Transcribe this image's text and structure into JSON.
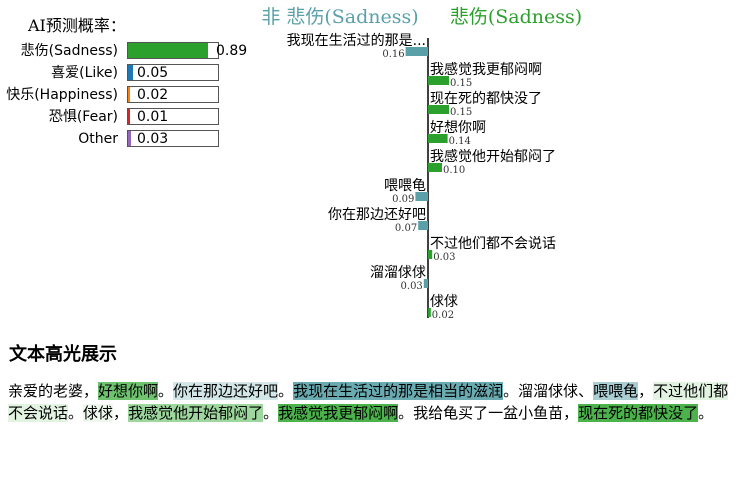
{
  "probability_panel": {
    "title": "AI预测概率：",
    "rows": [
      {
        "label": "悲伤(Sadness)",
        "value": 0.89,
        "value_text": "0.89",
        "color": "#2ca02c"
      },
      {
        "label": "喜爱(Like)",
        "value": 0.05,
        "value_text": "0.05",
        "color": "#1f77b4"
      },
      {
        "label": "快乐(Happiness)",
        "value": 0.02,
        "value_text": "0.02",
        "color": "#ff7f0e"
      },
      {
        "label": "恐惧(Fear)",
        "value": 0.01,
        "value_text": "0.01",
        "color": "#d62728"
      },
      {
        "label": "Other",
        "value": 0.03,
        "value_text": "0.03",
        "color": "#9467bd"
      }
    ]
  },
  "chart_data": {
    "type": "bar",
    "orientation": "horizontal",
    "legend": [
      {
        "label": "非 悲伤(Sadness)",
        "color": "#5aa0a8"
      },
      {
        "label": "悲伤(Sadness)",
        "color": "#2ca02c"
      }
    ],
    "colors": {
      "negative": "#5aa0a8",
      "positive": "#2ca02c"
    },
    "bars": [
      {
        "label": "我现在生活过的那是...",
        "value": -0.16,
        "value_text": "0.16"
      },
      {
        "label": "我感觉我更郁闷啊",
        "value": 0.15,
        "value_text": "0.15"
      },
      {
        "label": "现在死的都快没了",
        "value": 0.15,
        "value_text": "0.15"
      },
      {
        "label": "好想你啊",
        "value": 0.14,
        "value_text": "0.14"
      },
      {
        "label": "我感觉他开始郁闷了",
        "value": 0.1,
        "value_text": "0.10"
      },
      {
        "label": "喂喂龟",
        "value": -0.09,
        "value_text": "0.09"
      },
      {
        "label": "你在那边还好吧",
        "value": -0.07,
        "value_text": "0.07"
      },
      {
        "label": "不过他们都不会说话",
        "value": 0.03,
        "value_text": "0.03"
      },
      {
        "label": "溜溜俅俅",
        "value": -0.03,
        "value_text": "0.03"
      },
      {
        "label": "俅俅",
        "value": 0.02,
        "value_text": "0.02"
      }
    ]
  },
  "highlight": {
    "title": "文本高光展示",
    "segments": [
      {
        "text": "亲爱的老婆，",
        "bg": ""
      },
      {
        "text": "好想你啊",
        "bg": "#6fc36f"
      },
      {
        "text": "。",
        "bg": ""
      },
      {
        "text": "你在那边还好吧",
        "bg": "#d3e7e9"
      },
      {
        "text": "。",
        "bg": ""
      },
      {
        "text": "我现在生活过的那是相当的滋润",
        "bg": "#6aabb2"
      },
      {
        "text": "。溜溜俅俅、",
        "bg": ""
      },
      {
        "text": "喂喂龟",
        "bg": "#a9cdd1"
      },
      {
        "text": "，",
        "bg": ""
      },
      {
        "text": "不过他们都不会说话",
        "bg": "#e2f3e2"
      },
      {
        "text": "。",
        "bg": ""
      },
      {
        "text": "俅俅",
        "bg": "#eef8ee"
      },
      {
        "text": "，",
        "bg": ""
      },
      {
        "text": "我感觉他开始郁闷了",
        "bg": "#9ed79e"
      },
      {
        "text": "。",
        "bg": ""
      },
      {
        "text": "我感觉我更郁闷啊",
        "bg": "#4cb34c"
      },
      {
        "text": "。我给龟买了一盆小鱼苗，",
        "bg": ""
      },
      {
        "text": "现在死的都快没了",
        "bg": "#4cb34c"
      },
      {
        "text": "。",
        "bg": ""
      }
    ]
  }
}
